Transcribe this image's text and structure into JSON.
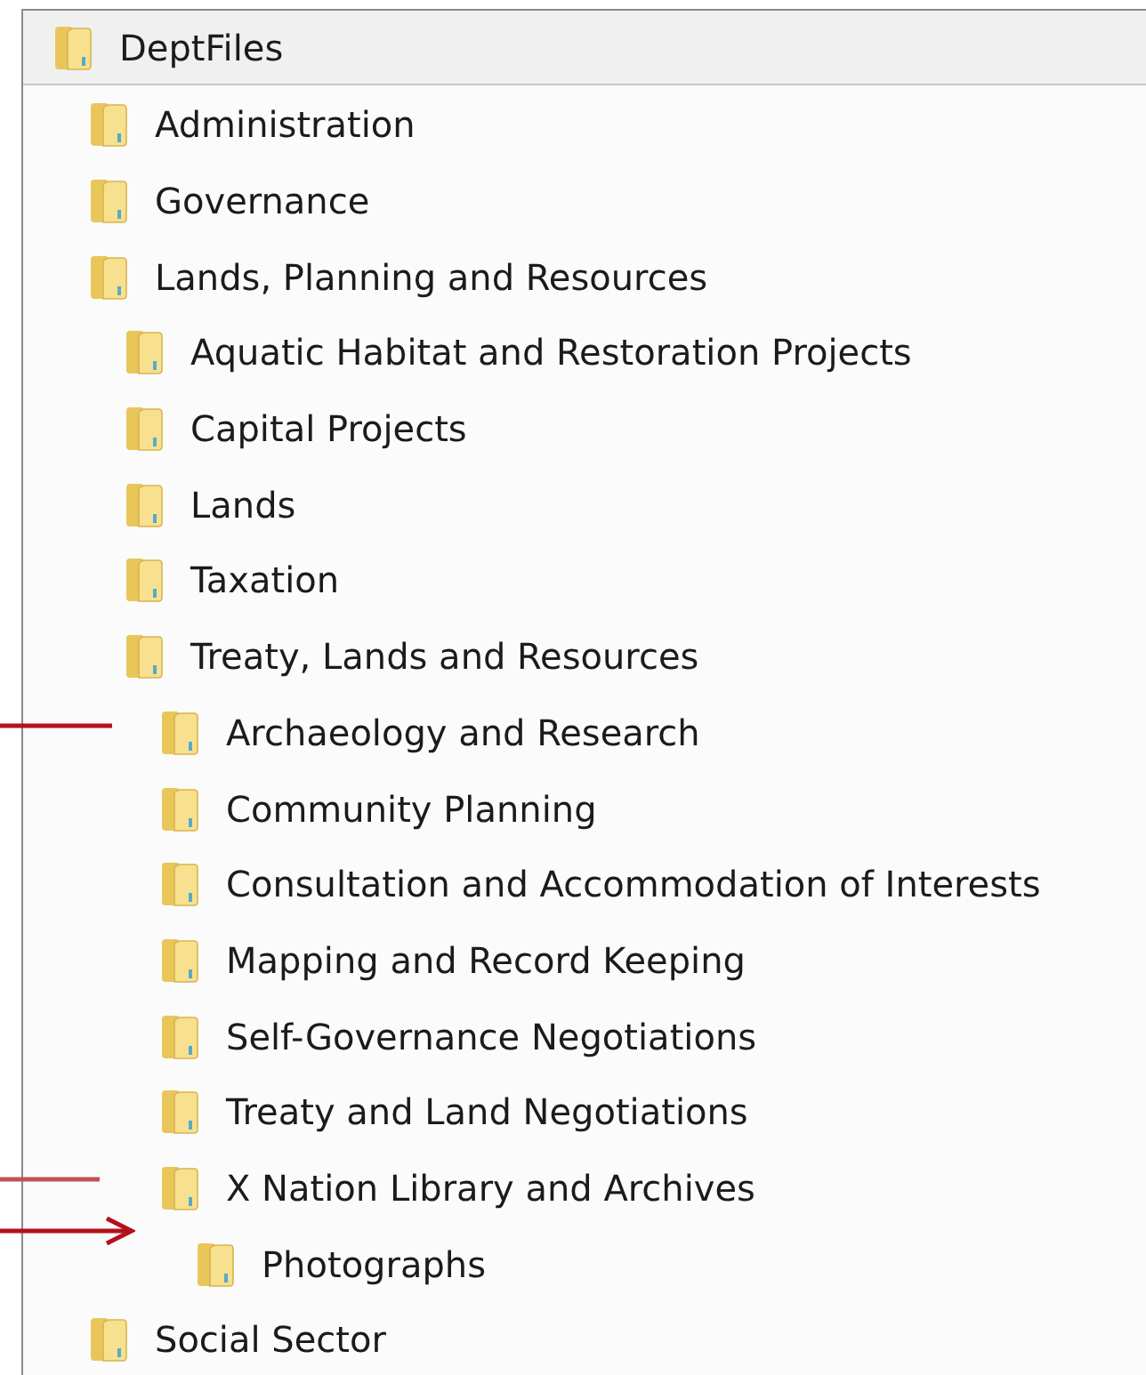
{
  "root": {
    "label": "DeptFiles",
    "children": [
      {
        "label": "Administration"
      },
      {
        "label": "Governance"
      },
      {
        "label": "Lands, Planning and Resources",
        "children": [
          {
            "label": "Aquatic Habitat and Restoration Projects"
          },
          {
            "label": "Capital Projects"
          },
          {
            "label": "Lands"
          },
          {
            "label": "Taxation"
          },
          {
            "label": "Treaty, Lands and Resources",
            "children": [
              {
                "label": "Archaeology and Research"
              },
              {
                "label": "Community Planning"
              },
              {
                "label": "Consultation and Accommodation of Interests"
              },
              {
                "label": "Mapping and Record Keeping"
              },
              {
                "label": "Self-Governance Negotiations"
              },
              {
                "label": "Treaty and Land Negotiations"
              },
              {
                "label": "X Nation Library and Archives",
                "children": [
                  {
                    "label": "Photographs"
                  }
                ]
              }
            ]
          }
        ]
      },
      {
        "label": "Social Sector"
      }
    ]
  }
}
